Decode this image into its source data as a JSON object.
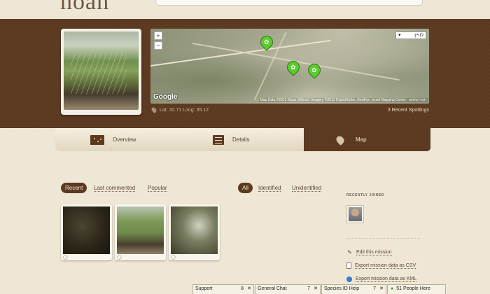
{
  "header": {
    "logo_fragment": "noah"
  },
  "mission": {
    "lat_long": "Lat: 32.71  Long: 35.12",
    "recent_spottings": "3 Recent Spottings"
  },
  "map": {
    "map_type": "לוויין",
    "google": "Google",
    "attribution": "Map Data ©2012 Mapa GISrael, Imagery ©2012 DigitalGlobe, GeoEye, Israel Mapping Center · תנאי שימוש",
    "zoom_in": "+",
    "zoom_out": "−",
    "pin_color": "#5ccb2d"
  },
  "tabs": [
    {
      "label": "Overview",
      "icon": "overview-icon",
      "active": false
    },
    {
      "label": "Details",
      "icon": "list-icon",
      "active": false
    },
    {
      "label": "Map",
      "icon": "map-pin-icon",
      "active": true
    }
  ],
  "filters": {
    "sort": [
      "Recent",
      "Last commented",
      "Popular"
    ],
    "sort_selected": "Recent",
    "status": [
      "All",
      "Identified",
      "Unidentified"
    ],
    "status_selected": "All"
  },
  "right": {
    "recently_joined": "RECENTLY JOINED",
    "actions": [
      {
        "label": "Edit this mission",
        "icon": "pencil-icon"
      },
      {
        "label": "Export mission data as CSV",
        "icon": "document-icon"
      },
      {
        "label": "Export mission data as KML",
        "icon": "globe-icon"
      }
    ]
  },
  "chat": [
    {
      "label": "Support",
      "count": "8"
    },
    {
      "label": "General Chat",
      "count": "7"
    },
    {
      "label": "Species ID Help",
      "count": "7"
    },
    {
      "label": "51 People Here",
      "count": ""
    }
  ],
  "colors": {
    "brown": "#5c3a21",
    "paper": "#efe7d6"
  }
}
